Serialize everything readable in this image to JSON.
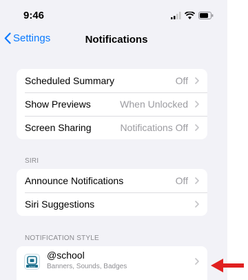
{
  "status_bar": {
    "time": "9:46",
    "icons": [
      "cellular-signal-icon",
      "wifi-icon",
      "battery-icon"
    ]
  },
  "nav": {
    "back_label": "Settings",
    "title": "Notifications"
  },
  "group1": {
    "rows": [
      {
        "label": "Scheduled Summary",
        "value": "Off"
      },
      {
        "label": "Show Previews",
        "value": "When Unlocked"
      },
      {
        "label": "Screen Sharing",
        "value": "Notifications Off"
      }
    ]
  },
  "siri": {
    "header": "SIRI",
    "rows": [
      {
        "label": "Announce Notifications",
        "value": "Off"
      },
      {
        "label": "Siri Suggestions",
        "value": ""
      }
    ]
  },
  "notification_style": {
    "header": "NOTIFICATION STYLE",
    "apps": [
      {
        "name": "@school",
        "subtitle": "Banners, Sounds, Badges",
        "icon_text": "school"
      }
    ]
  },
  "colors": {
    "accent": "#0a7aff",
    "background": "#f2f2f7",
    "secondary_text": "#9b9ba0",
    "annotation_arrow": "#e02020",
    "app_icon": "#1b6f8c"
  }
}
